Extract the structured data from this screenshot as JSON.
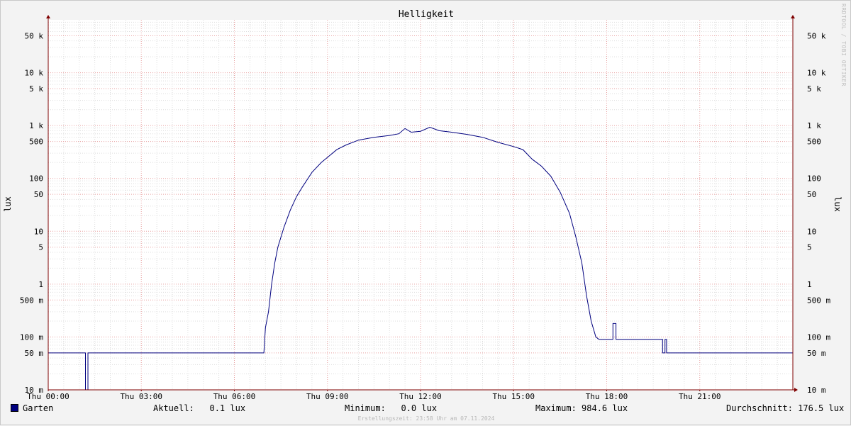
{
  "chart_data": {
    "type": "line",
    "title": "Helligkeit",
    "ylabel": "lux",
    "y_scale": "log",
    "ylim": [
      0.01,
      100000
    ],
    "xlim_hours": [
      0,
      24
    ],
    "grid": true,
    "colors": {
      "line": "#00007f",
      "grid_major": "#e8a0a0",
      "grid_minor": "#dddddd",
      "axis": "#7f0000"
    },
    "x_ticks": [
      {
        "h": 0,
        "label": "Thu 00:00"
      },
      {
        "h": 3,
        "label": "Thu 03:00"
      },
      {
        "h": 6,
        "label": "Thu 06:00"
      },
      {
        "h": 9,
        "label": "Thu 09:00"
      },
      {
        "h": 12,
        "label": "Thu 12:00"
      },
      {
        "h": 15,
        "label": "Thu 15:00"
      },
      {
        "h": 18,
        "label": "Thu 18:00"
      },
      {
        "h": 21,
        "label": "Thu 21:00"
      }
    ],
    "y_ticks": [
      {
        "v": 50000,
        "label": "50 k"
      },
      {
        "v": 10000,
        "label": "10 k"
      },
      {
        "v": 5000,
        "label": "5 k"
      },
      {
        "v": 1000,
        "label": "1 k"
      },
      {
        "v": 500,
        "label": "500"
      },
      {
        "v": 100,
        "label": "100"
      },
      {
        "v": 50,
        "label": "50"
      },
      {
        "v": 10,
        "label": "10"
      },
      {
        "v": 5,
        "label": "5"
      },
      {
        "v": 1,
        "label": "1"
      },
      {
        "v": 0.5,
        "label": "500 m"
      },
      {
        "v": 0.1,
        "label": "100 m"
      },
      {
        "v": 0.05,
        "label": "50 m"
      },
      {
        "v": 0.01,
        "label": "10 m"
      }
    ],
    "series": [
      {
        "name": "Garten",
        "color": "#00007f",
        "points": [
          [
            0,
            0.05
          ],
          [
            1.2,
            0.05
          ],
          [
            1.2,
            0.01
          ],
          [
            1.28,
            0.01
          ],
          [
            1.28,
            0.05
          ],
          [
            6.95,
            0.05
          ],
          [
            7.0,
            0.15
          ],
          [
            7.1,
            0.3
          ],
          [
            7.2,
            1.0
          ],
          [
            7.3,
            2.5
          ],
          [
            7.4,
            5
          ],
          [
            7.6,
            12
          ],
          [
            7.8,
            25
          ],
          [
            8.0,
            45
          ],
          [
            8.2,
            70
          ],
          [
            8.5,
            130
          ],
          [
            8.8,
            200
          ],
          [
            9.0,
            250
          ],
          [
            9.3,
            350
          ],
          [
            9.6,
            430
          ],
          [
            10.0,
            530
          ],
          [
            10.5,
            600
          ],
          [
            11.0,
            650
          ],
          [
            11.3,
            700
          ],
          [
            11.5,
            880
          ],
          [
            11.7,
            750
          ],
          [
            12.0,
            780
          ],
          [
            12.3,
            930
          ],
          [
            12.6,
            800
          ],
          [
            13.0,
            750
          ],
          [
            13.5,
            680
          ],
          [
            14.0,
            600
          ],
          [
            14.5,
            480
          ],
          [
            15.0,
            400
          ],
          [
            15.3,
            350
          ],
          [
            15.6,
            230
          ],
          [
            15.9,
            170
          ],
          [
            16.2,
            110
          ],
          [
            16.5,
            55
          ],
          [
            16.8,
            22
          ],
          [
            17.0,
            8
          ],
          [
            17.2,
            2.5
          ],
          [
            17.35,
            0.6
          ],
          [
            17.5,
            0.2
          ],
          [
            17.65,
            0.1
          ],
          [
            17.75,
            0.09
          ],
          [
            18.2,
            0.09
          ],
          [
            18.2,
            0.18
          ],
          [
            18.3,
            0.18
          ],
          [
            18.3,
            0.09
          ],
          [
            19.8,
            0.09
          ],
          [
            19.8,
            0.05
          ],
          [
            19.88,
            0.05
          ],
          [
            19.88,
            0.09
          ],
          [
            19.93,
            0.09
          ],
          [
            19.93,
            0.05
          ],
          [
            24.0,
            0.05
          ]
        ]
      }
    ]
  },
  "legend": {
    "series_name": "Garten",
    "series_color": "#00007f",
    "aktuell_label": "Aktuell:",
    "aktuell_value": "0.1 lux",
    "minimum_label": "Minimum:",
    "minimum_value": "0.0 lux",
    "maximum_label": "Maximum:",
    "maximum_value": "984.6 lux",
    "durchschnitt_label": "Durchschnitt:",
    "durchschnitt_value": "176.5 lux"
  },
  "footer": "Erstellungszeit: 23:58 Uhr am 07.11.2024",
  "watermark": "RRDTOOL / TOBI OETIKER"
}
